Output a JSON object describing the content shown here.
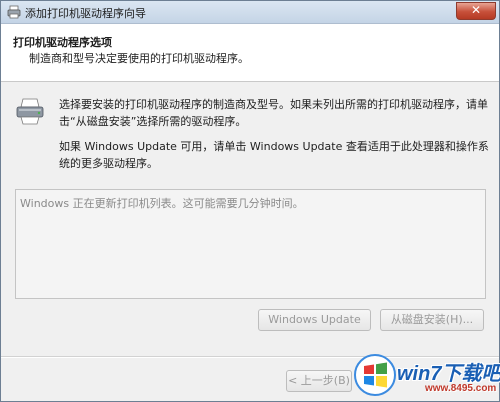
{
  "window": {
    "title": "添加打印机驱动程序向导",
    "close_glyph": "✕"
  },
  "header": {
    "title": "打印机驱动程序选项",
    "subtitle": "制造商和型号决定要使用的打印机驱动程序。"
  },
  "body": {
    "paragraph1": "选择要安装的打印机驱动程序的制造商及型号。如果未列出所需的打印机驱动程序，请单击“从磁盘安装”选择所需的驱动程序。",
    "paragraph2": "如果 Windows Update 可用，请单击 Windows Update 查看适用于此处理器和操作系统的更多驱动程序。"
  },
  "listbox": {
    "message": "Windows 正在更新打印机列表。这可能需要几分钟时间。"
  },
  "buttons": {
    "windows_update": "Windows Update",
    "have_disk": "从磁盘安装(H)...",
    "back": "< 上一步(B)"
  },
  "watermark": {
    "brand": "win7下载吧",
    "url": "www.8495.com"
  },
  "icons": {
    "title_icon": "printer-icon",
    "body_icon": "printer-icon",
    "close_icon": "close-icon",
    "watermark_logo": "windows-logo"
  },
  "colors": {
    "close_button": "#c7503a",
    "watermark_brand": "#1a5fb4",
    "watermark_url": "#c0392b"
  }
}
